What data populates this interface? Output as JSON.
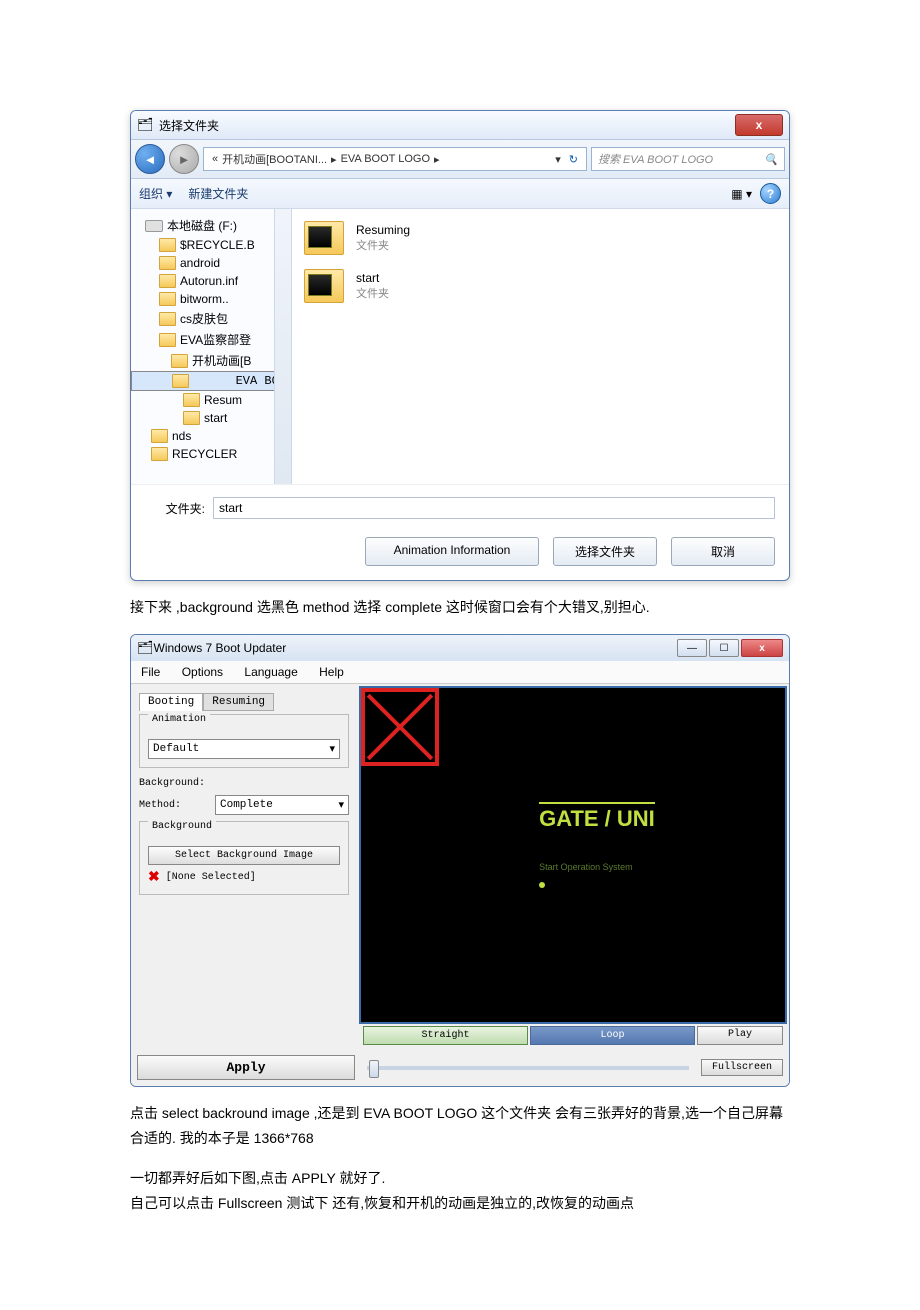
{
  "doc": {
    "para1": "接下来 ,background 选黑色   method 选择 complete 这时候窗口会有个大错叉,别担心.",
    "para2": "点击 select backround image ,还是到 EVA BOOT LOGO 这个文件夹 会有三张弄好的背景,选一个自己屏幕合适的. 我的本子是 1366*768",
    "para3": "一切都弄好后如下图,点击 APPLY 就好了.",
    "para4": "自己可以点击 Fullscreen 测试下   还有,恢复和开机的动画是独立的,改恢复的动画点"
  },
  "dialog1": {
    "title": "选择文件夹",
    "close": "x",
    "breadcrumb": {
      "a": "«",
      "b": "开机动画[BOOTANI...",
      "c": "▸",
      "d": "EVA BOOT LOGO",
      "e": "▸"
    },
    "search_placeholder": "搜索 EVA BOOT LOGO",
    "toolbar": {
      "organize": "组织 ▾",
      "newfolder": "新建文件夹"
    },
    "tree": [
      {
        "label": "本地磁盘 (F:)",
        "type": "disk"
      },
      {
        "label": "$RECYCLE.B"
      },
      {
        "label": "android"
      },
      {
        "label": "Autorun.inf"
      },
      {
        "label": "bitworm.."
      },
      {
        "label": "cs皮肤包"
      },
      {
        "label": "EVA监察部登"
      },
      {
        "label": "开机动画[B",
        "indent": true
      },
      {
        "label": "EVA BOO",
        "indent": true,
        "sel": true
      },
      {
        "label": "Resum",
        "indent2": true
      },
      {
        "label": "start",
        "indent2": true
      },
      {
        "label": "nds"
      },
      {
        "label": "RECYCLER"
      }
    ],
    "items": [
      {
        "name": "Resuming",
        "sub": "文件夹"
      },
      {
        "name": "start",
        "sub": "文件夹"
      }
    ],
    "folder_label": "文件夹:",
    "folder_value": "start",
    "buttons": {
      "info": "Animation Information",
      "select": "选择文件夹",
      "cancel": "取消"
    }
  },
  "dialog2": {
    "title": "Windows 7 Boot Updater",
    "menu": {
      "file": "File",
      "options": "Options",
      "language": "Language",
      "help": "Help"
    },
    "tabs": {
      "booting": "Booting",
      "resuming": "Resuming"
    },
    "animation_group": "Animation",
    "animation_value": "Default",
    "bg_label": "Background:",
    "method_label": "Method:",
    "method_value": "Complete",
    "bg_group": "Background",
    "select_bg_btn": "Select Background Image",
    "none_selected": "[None Selected]",
    "preview": {
      "gate": "GATE / UNI",
      "sub": "Start Operation System"
    },
    "seg_straight": "Straight",
    "seg_loop": "Loop",
    "play": "Play",
    "fullscreen": "Fullscreen",
    "apply": "Apply"
  }
}
